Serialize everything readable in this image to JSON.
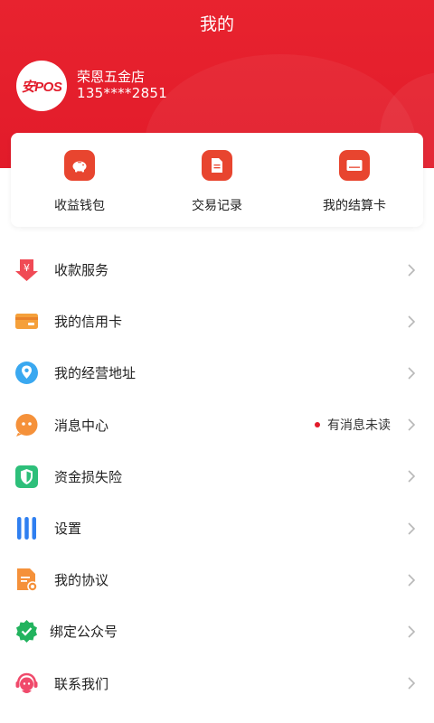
{
  "header": {
    "title": "我的",
    "background_color": "#e21b2a"
  },
  "profile": {
    "avatar_text": "安POS",
    "name": "荣恩五金店",
    "phone": "135****2851"
  },
  "quick_actions": [
    {
      "label": "收益钱包",
      "icon": "piggy-bank-icon"
    },
    {
      "label": "交易记录",
      "icon": "document-icon"
    },
    {
      "label": "我的结算卡",
      "icon": "card-icon"
    }
  ],
  "menu": [
    {
      "label": "收款服务",
      "icon": "yuan-download-icon"
    },
    {
      "label": "我的信用卡",
      "icon": "credit-card-icon"
    },
    {
      "label": "我的经营地址",
      "icon": "location-pin-icon"
    },
    {
      "label": "消息中心",
      "icon": "chat-bubble-icon",
      "notice": "有消息未读"
    },
    {
      "label": "资金损失险",
      "icon": "shield-icon"
    },
    {
      "label": "设置",
      "icon": "settings-bars-icon"
    },
    {
      "label": "我的协议",
      "icon": "agreement-document-icon"
    },
    {
      "label": "绑定公众号",
      "icon": "verified-badge-icon"
    },
    {
      "label": "联系我们",
      "icon": "customer-service-icon"
    }
  ],
  "colors": {
    "accent": "#e21b2a",
    "quick_icon": "#e8452f",
    "chevron": "#b8b8b8"
  }
}
